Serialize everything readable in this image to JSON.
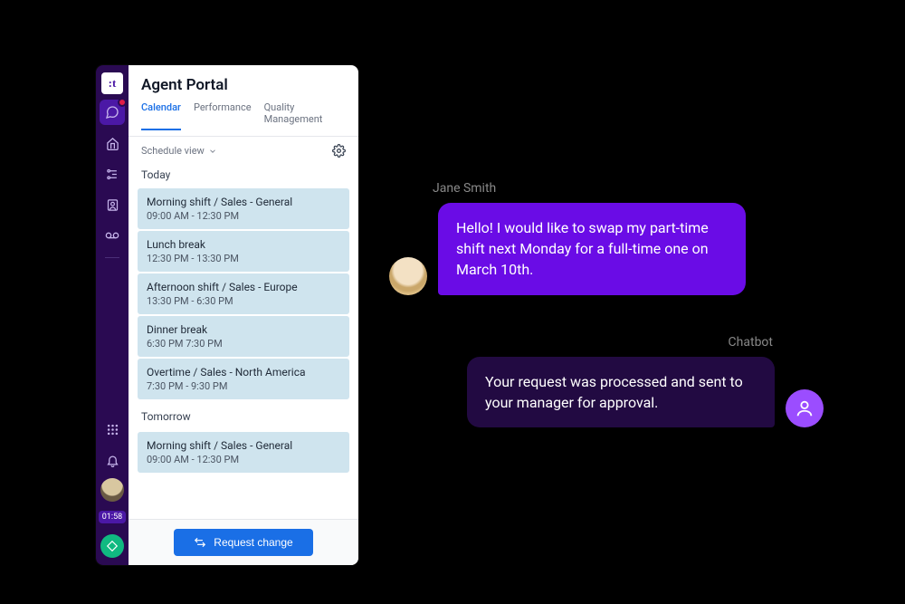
{
  "sidebar": {
    "logo": ":t",
    "time": "01:58",
    "icons": [
      "chat",
      "home",
      "flow",
      "contact",
      "voicemail",
      "dialpad",
      "bell"
    ]
  },
  "portal": {
    "title": "Agent Portal",
    "tabs": [
      {
        "label": "Calendar",
        "active": true
      },
      {
        "label": "Performance",
        "active": false
      },
      {
        "label": "Quality Management",
        "active": false
      }
    ],
    "view_label": "Schedule view",
    "today_label": "Today",
    "tomorrow_label": "Tomorrow",
    "today": [
      {
        "title": "Morning shift / Sales - General",
        "time": "09:00 AM - 12:30 PM"
      },
      {
        "title": "Lunch break",
        "time": "12:30 PM - 13:30 PM"
      },
      {
        "title": "Afternoon shift / Sales - Europe",
        "time": "13:30 PM - 6:30 PM"
      },
      {
        "title": "Dinner break",
        "time": "6:30 PM 7:30 PM"
      },
      {
        "title": "Overtime / Sales - North America",
        "time": "7:30 PM - 9:30 PM"
      }
    ],
    "tomorrow": [
      {
        "title": "Morning shift / Sales - General",
        "time": "09:00 AM - 12:30 PM"
      }
    ],
    "request_label": "Request change"
  },
  "chat": {
    "sender_name": "Jane Smith",
    "bot_name": "Chatbot",
    "user_msg": "Hello! I would like to swap my part-time shift next Monday for a full-time one on March 10th.",
    "bot_msg": "Your request was processed and sent to your manager for approval."
  }
}
